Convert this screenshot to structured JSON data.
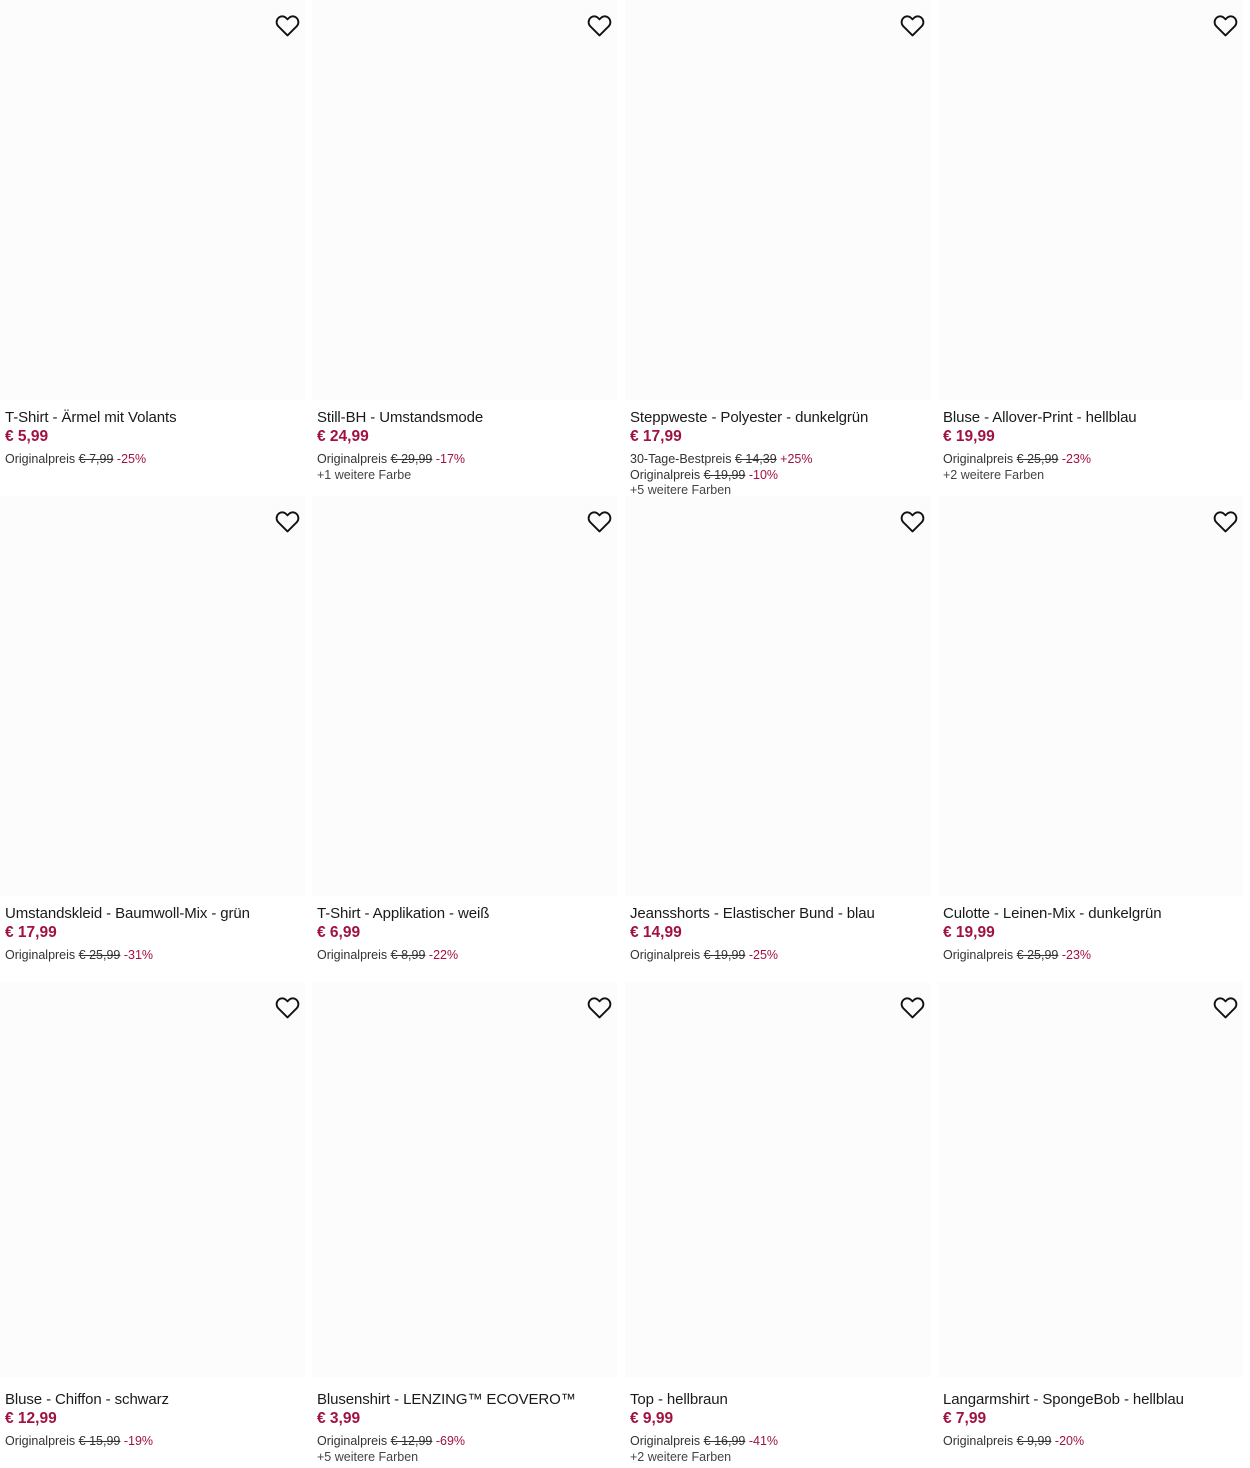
{
  "colors": {
    "price": "#a0123f",
    "discount": "#a0123f",
    "text": "#1a1a1a",
    "image_placeholder": "#fcfcfc"
  },
  "products": [
    {
      "title": "T-Shirt - Ärmel mit Volants",
      "price": "€ 5,99",
      "lines": [
        {
          "label": "Originalpreis",
          "old": "€ 7,99",
          "change": "-25%"
        }
      ],
      "more_colors": "",
      "wishlist_icon": "heart-outline-icon"
    },
    {
      "title": "Still-BH - Umstandsmode",
      "price": "€ 24,99",
      "lines": [
        {
          "label": "Originalpreis",
          "old": "€ 29,99",
          "change": "-17%"
        }
      ],
      "more_colors": "+1 weitere Farbe",
      "wishlist_icon": "heart-outline-icon"
    },
    {
      "title": "Steppweste - Polyester - dunkelgrün",
      "price": "€ 17,99",
      "lines": [
        {
          "label": "30-Tage-Bestpreis",
          "old": "€ 14,39",
          "change": "+25%"
        },
        {
          "label": "Originalpreis",
          "old": "€ 19,99",
          "change": "-10%"
        }
      ],
      "more_colors": "+5 weitere Farben",
      "wishlist_icon": "heart-outline-icon"
    },
    {
      "title": "Bluse - Allover-Print - hellblau",
      "price": "€ 19,99",
      "lines": [
        {
          "label": "Originalpreis",
          "old": "€ 25,99",
          "change": "-23%"
        }
      ],
      "more_colors": "+2 weitere Farben",
      "wishlist_icon": "heart-outline-icon"
    },
    {
      "title": "Umstandskleid - Baumwoll-Mix - grün",
      "price": "€ 17,99",
      "lines": [
        {
          "label": "Originalpreis",
          "old": "€ 25,99",
          "change": "-31%"
        }
      ],
      "more_colors": "",
      "wishlist_icon": "heart-outline-icon"
    },
    {
      "title": "T-Shirt - Applikation - weiß",
      "price": "€ 6,99",
      "lines": [
        {
          "label": "Originalpreis",
          "old": "€ 8,99",
          "change": "-22%"
        }
      ],
      "more_colors": "",
      "wishlist_icon": "heart-outline-icon"
    },
    {
      "title": "Jeansshorts - Elastischer Bund - blau",
      "price": "€ 14,99",
      "lines": [
        {
          "label": "Originalpreis",
          "old": "€ 19,99",
          "change": "-25%"
        }
      ],
      "more_colors": "",
      "wishlist_icon": "heart-outline-icon"
    },
    {
      "title": "Culotte - Leinen-Mix - dunkelgrün",
      "price": "€ 19,99",
      "lines": [
        {
          "label": "Originalpreis",
          "old": "€ 25,99",
          "change": "-23%"
        }
      ],
      "more_colors": "",
      "wishlist_icon": "heart-outline-icon"
    },
    {
      "title": "Bluse - Chiffon - schwarz",
      "price": "€ 12,99",
      "lines": [
        {
          "label": "Originalpreis",
          "old": "€ 15,99",
          "change": "-19%"
        }
      ],
      "more_colors": "",
      "wishlist_icon": "heart-outline-icon"
    },
    {
      "title": "Blusenshirt - LENZING™ ECOVERO™",
      "price": "€ 3,99",
      "lines": [
        {
          "label": "Originalpreis",
          "old": "€ 12,99",
          "change": "-69%"
        }
      ],
      "more_colors": "+5 weitere Farben",
      "wishlist_icon": "heart-outline-icon"
    },
    {
      "title": "Top - hellbraun",
      "price": "€ 9,99",
      "lines": [
        {
          "label": "Originalpreis",
          "old": "€ 16,99",
          "change": "-41%"
        }
      ],
      "more_colors": "+2 weitere Farben",
      "wishlist_icon": "heart-outline-icon"
    },
    {
      "title": "Langarmshirt - SpongeBob - hellblau",
      "price": "€ 7,99",
      "lines": [
        {
          "label": "Originalpreis",
          "old": "€ 9,99",
          "change": "-20%"
        }
      ],
      "more_colors": "",
      "wishlist_icon": "heart-outline-icon"
    }
  ]
}
